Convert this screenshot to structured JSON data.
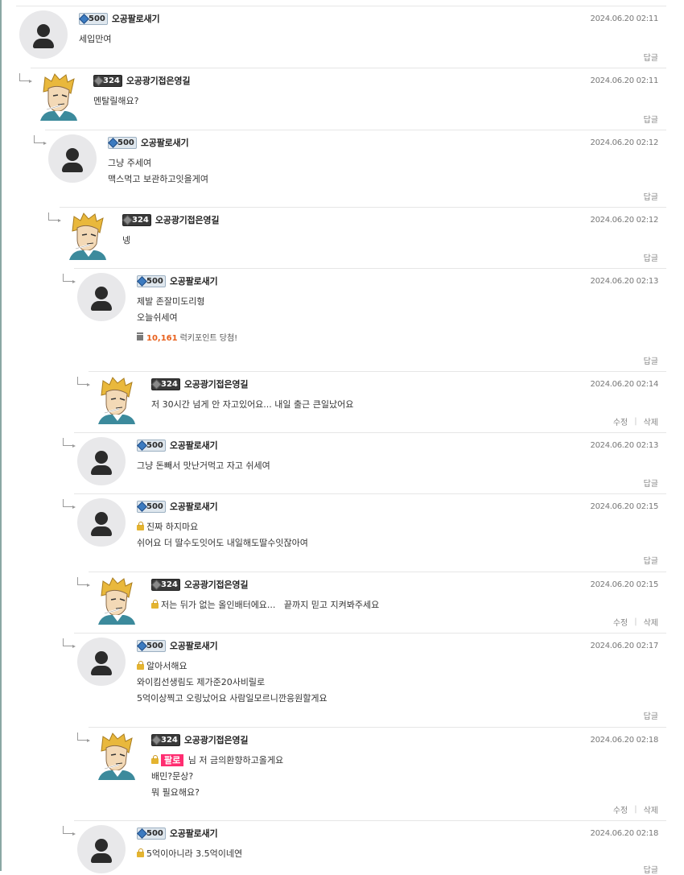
{
  "thread": {
    "comments": [
      {
        "level": "500",
        "author": "오공팔로새기",
        "time": "2024.06.20 02:11",
        "lines": [
          "세입만여"
        ],
        "reply_label": "답글"
      },
      {
        "level": "324",
        "author": "오공광기접은영길",
        "time": "2024.06.20 02:11",
        "lines": [
          "멘탈릴해요?"
        ],
        "reply_label": "답글"
      },
      {
        "level": "500",
        "author": "오공팔로새기",
        "time": "2024.06.20 02:12",
        "lines": [
          "그냥 주세여",
          "맥스먹고 보관하고잇을게여"
        ],
        "reply_label": "답글"
      },
      {
        "level": "324",
        "author": "오공광기접은영길",
        "time": "2024.06.20 02:12",
        "lines": [
          "넹"
        ],
        "reply_label": "답글"
      },
      {
        "level": "500",
        "author": "오공팔로새기",
        "time": "2024.06.20 02:13",
        "lines": [
          "제발 존잘미도리형",
          "오늘쉬세여"
        ],
        "lucky": {
          "points": "10,161",
          "text": "럭키포인트 당첨!"
        },
        "reply_label": "답글"
      },
      {
        "level": "324",
        "author": "오공광기접은영길",
        "time": "2024.06.20 02:14",
        "lines": [
          "저 30시간 넘게 안 자고있어요... 내일 출근 큰일났어요"
        ],
        "edit_label": "수정",
        "delete_label": "삭제"
      },
      {
        "level": "500",
        "author": "오공팔로새기",
        "time": "2024.06.20 02:13",
        "lines": [
          "그냥 돈빼서 맛난거먹고 자고 쉬세여"
        ],
        "reply_label": "답글"
      },
      {
        "level": "500",
        "author": "오공팔로새기",
        "time": "2024.06.20 02:15",
        "lines": [
          "진짜 하지마요",
          "쉬어요 더 딸수도잇어도 내일해도딸수잇잖아여"
        ],
        "reply_label": "답글"
      },
      {
        "level": "324",
        "author": "오공광기접은영길",
        "time": "2024.06.20 02:15",
        "lines": [
          "저는 뒤가 없는 올인배터에요...   끝까지 믿고 지켜봐주세요"
        ],
        "edit_label": "수정",
        "delete_label": "삭제"
      },
      {
        "level": "500",
        "author": "오공팔로새기",
        "time": "2024.06.20 02:17",
        "lines": [
          "알아서해요",
          "와이킴선생림도 제가준20사비릴로",
          "5억이상찍고 오링났어요 사람일모르니깐응원할게요"
        ],
        "reply_label": "답글"
      },
      {
        "level": "324",
        "author": "오공광기접은영길",
        "time": "2024.06.20 02:18",
        "mention": "팔로",
        "lines": [
          "님 저 금의환향하고올게요",
          "배민?문상?",
          "뭐 필요해요?"
        ],
        "edit_label": "수정",
        "delete_label": "삭제"
      },
      {
        "level": "500",
        "author": "오공팔로새기",
        "time": "2024.06.20 02:18",
        "lines": [
          "5억이아니라 3.5억이네연"
        ],
        "reply_label": "답글"
      }
    ]
  },
  "icons": {
    "avatar_default": "user-silhouette-icon",
    "avatar_custom": "anime-character-avatar",
    "reply_indent": "reply-arrow-icon",
    "secret": "lock-icon",
    "lucky": "gift-icon",
    "level_badge": "level-badge-icon"
  },
  "colors": {
    "lucky_points": "#e8601c",
    "mention_tag_bg": "#ff2d71",
    "lock": "#e4b430"
  }
}
